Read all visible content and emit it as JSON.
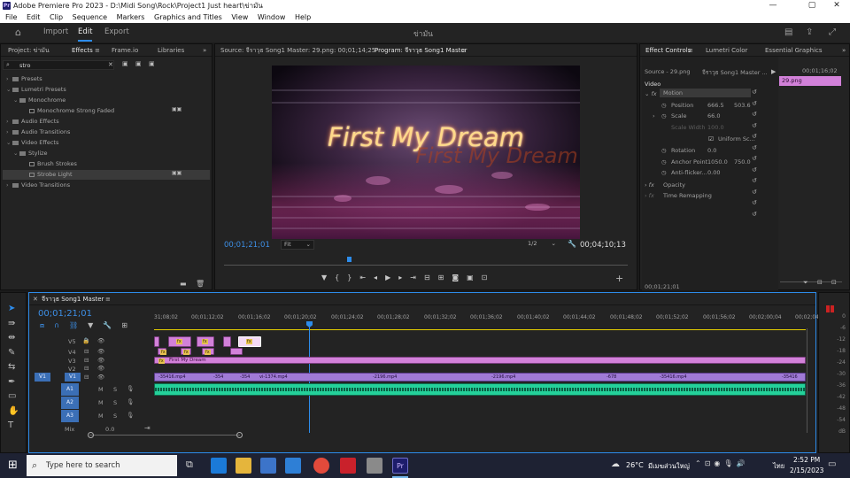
{
  "window": {
    "title": "Adobe Premiere Pro 2023 - D:\\Midi Song\\Rock\\Project1 Just heart\\ข่ามัน",
    "app_icon": "Pr"
  },
  "menu": [
    "File",
    "Edit",
    "Clip",
    "Sequence",
    "Markers",
    "Graphics and Titles",
    "View",
    "Window",
    "Help"
  ],
  "workspaces": {
    "import": "Import",
    "edit": "Edit",
    "export": "Export",
    "center_title": "ข่ามัน"
  },
  "left_panel": {
    "project_tab": "Project: ข่ามัน",
    "effects_tab": "Effects",
    "frameio_tab": "Frame.io",
    "libraries_tab": "Libraries",
    "search_value": "stro",
    "tree": [
      "Presets",
      "Lumetri Presets",
      "Monochrome",
      "Monochrome Strong Faded",
      "Audio Effects",
      "Audio Transitions",
      "Video Effects",
      "Stylize",
      "Brush Strokes",
      "Strobe Light",
      "Video Transitions"
    ]
  },
  "source_monitor": {
    "tab": "Source: จีราวุธ Song1 Master: 29.png: 00;01;14;25"
  },
  "program_monitor": {
    "tab": "Program: จีราวุธ Song1 Master",
    "title_text": "First My Dream",
    "timecode": "00;01;21;01",
    "fit": "Fit",
    "ratio": "1/2",
    "duration": "00;04;10;13",
    "playhead_fraction": 0.31
  },
  "effect_controls": {
    "tab": "Effect Controls",
    "lumetri_tab": "Lumetri Color",
    "essential_tab": "Essential Graphics",
    "source": "Source - 29.png",
    "master": "จีราวุธ Song1 Master ...",
    "time": "00;01;16;02",
    "clip": "29.png",
    "video": "Video",
    "motion": "Motion",
    "position": "Position",
    "pos_x": "666.5",
    "pos_y": "503.6",
    "scale": "Scale",
    "scale_val": "66.0",
    "scale_width": "Scale Width",
    "scale_width_val": "100.0",
    "uniform": "Uniform Sc...",
    "rotation": "Rotation",
    "rotation_val": "0.0",
    "anchor": "Anchor Point",
    "anchor_x": "1050.0",
    "anchor_y": "750.0",
    "antiflicker": "Anti-flicker...",
    "antiflicker_val": "0.00",
    "opacity": "Opacity",
    "remap": "Time Remapping",
    "footer_time": "00;01;21;01"
  },
  "timeline": {
    "tab": "จีราวุธ Song1 Master",
    "timecode": "00;01;21;01",
    "ruler": [
      "31;08;02",
      "00;01;12;02",
      "00;01;16;02",
      "00;01;20;02",
      "00;01;24;02",
      "00;01;28;02",
      "00;01;32;02",
      "00;01;36;02",
      "00;01;40;02",
      "00;01;44;02",
      "00;01;48;02",
      "00;01;52;02",
      "00;01;56;02",
      "00;02;00;04",
      "00;02;04;04"
    ],
    "tracks_v": [
      "V5",
      "V4",
      "V3",
      "V2",
      "V1"
    ],
    "tracks_a": [
      "A1",
      "A2",
      "A3"
    ],
    "mix": "Mix",
    "mix_val": "0.0",
    "v3_clip": "First My Dream",
    "v1_clips": [
      "-35416.mp4",
      "-354",
      "-354",
      "vi-1374.mp4",
      "-2196.mp4",
      "-2196.mp4",
      "-678",
      "-35416.mp4",
      "-35416"
    ],
    "meter": [
      "0",
      "-6",
      "-12",
      "-18",
      "-24",
      "-30",
      "-36",
      "-42",
      "-48",
      "-54",
      "dB"
    ]
  },
  "taskbar": {
    "search": "Type here to search",
    "weather": "26°C",
    "weather_text": "มีเมฆส่วนใหญ่",
    "lang": "ไทย",
    "time": "2:52 PM",
    "date": "2/15/2023"
  },
  "colors": {
    "accent": "#2d8ceb",
    "video_clip": "#d281d9",
    "audio_clip": "#24d19a",
    "title": "#ffd98a"
  }
}
